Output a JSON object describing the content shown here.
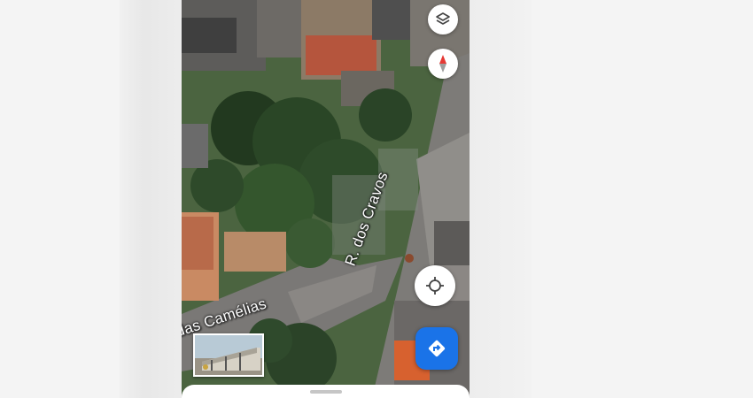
{
  "map": {
    "street_labels": {
      "rua_cravos": "R. dos Cravos",
      "rua_camelias": "das Camélias"
    }
  },
  "controls": {
    "layers": {
      "icon": "layers-icon"
    },
    "compass": {
      "icon": "compass-icon"
    },
    "my_location": {
      "icon": "crosshair-icon"
    },
    "directions": {
      "icon": "directions-icon",
      "color": "#1a73e8"
    }
  },
  "street_view_thumbnail": {
    "icon": "street-view-thumbnail"
  },
  "bottom_sheet": {
    "handle": "drag-handle"
  }
}
